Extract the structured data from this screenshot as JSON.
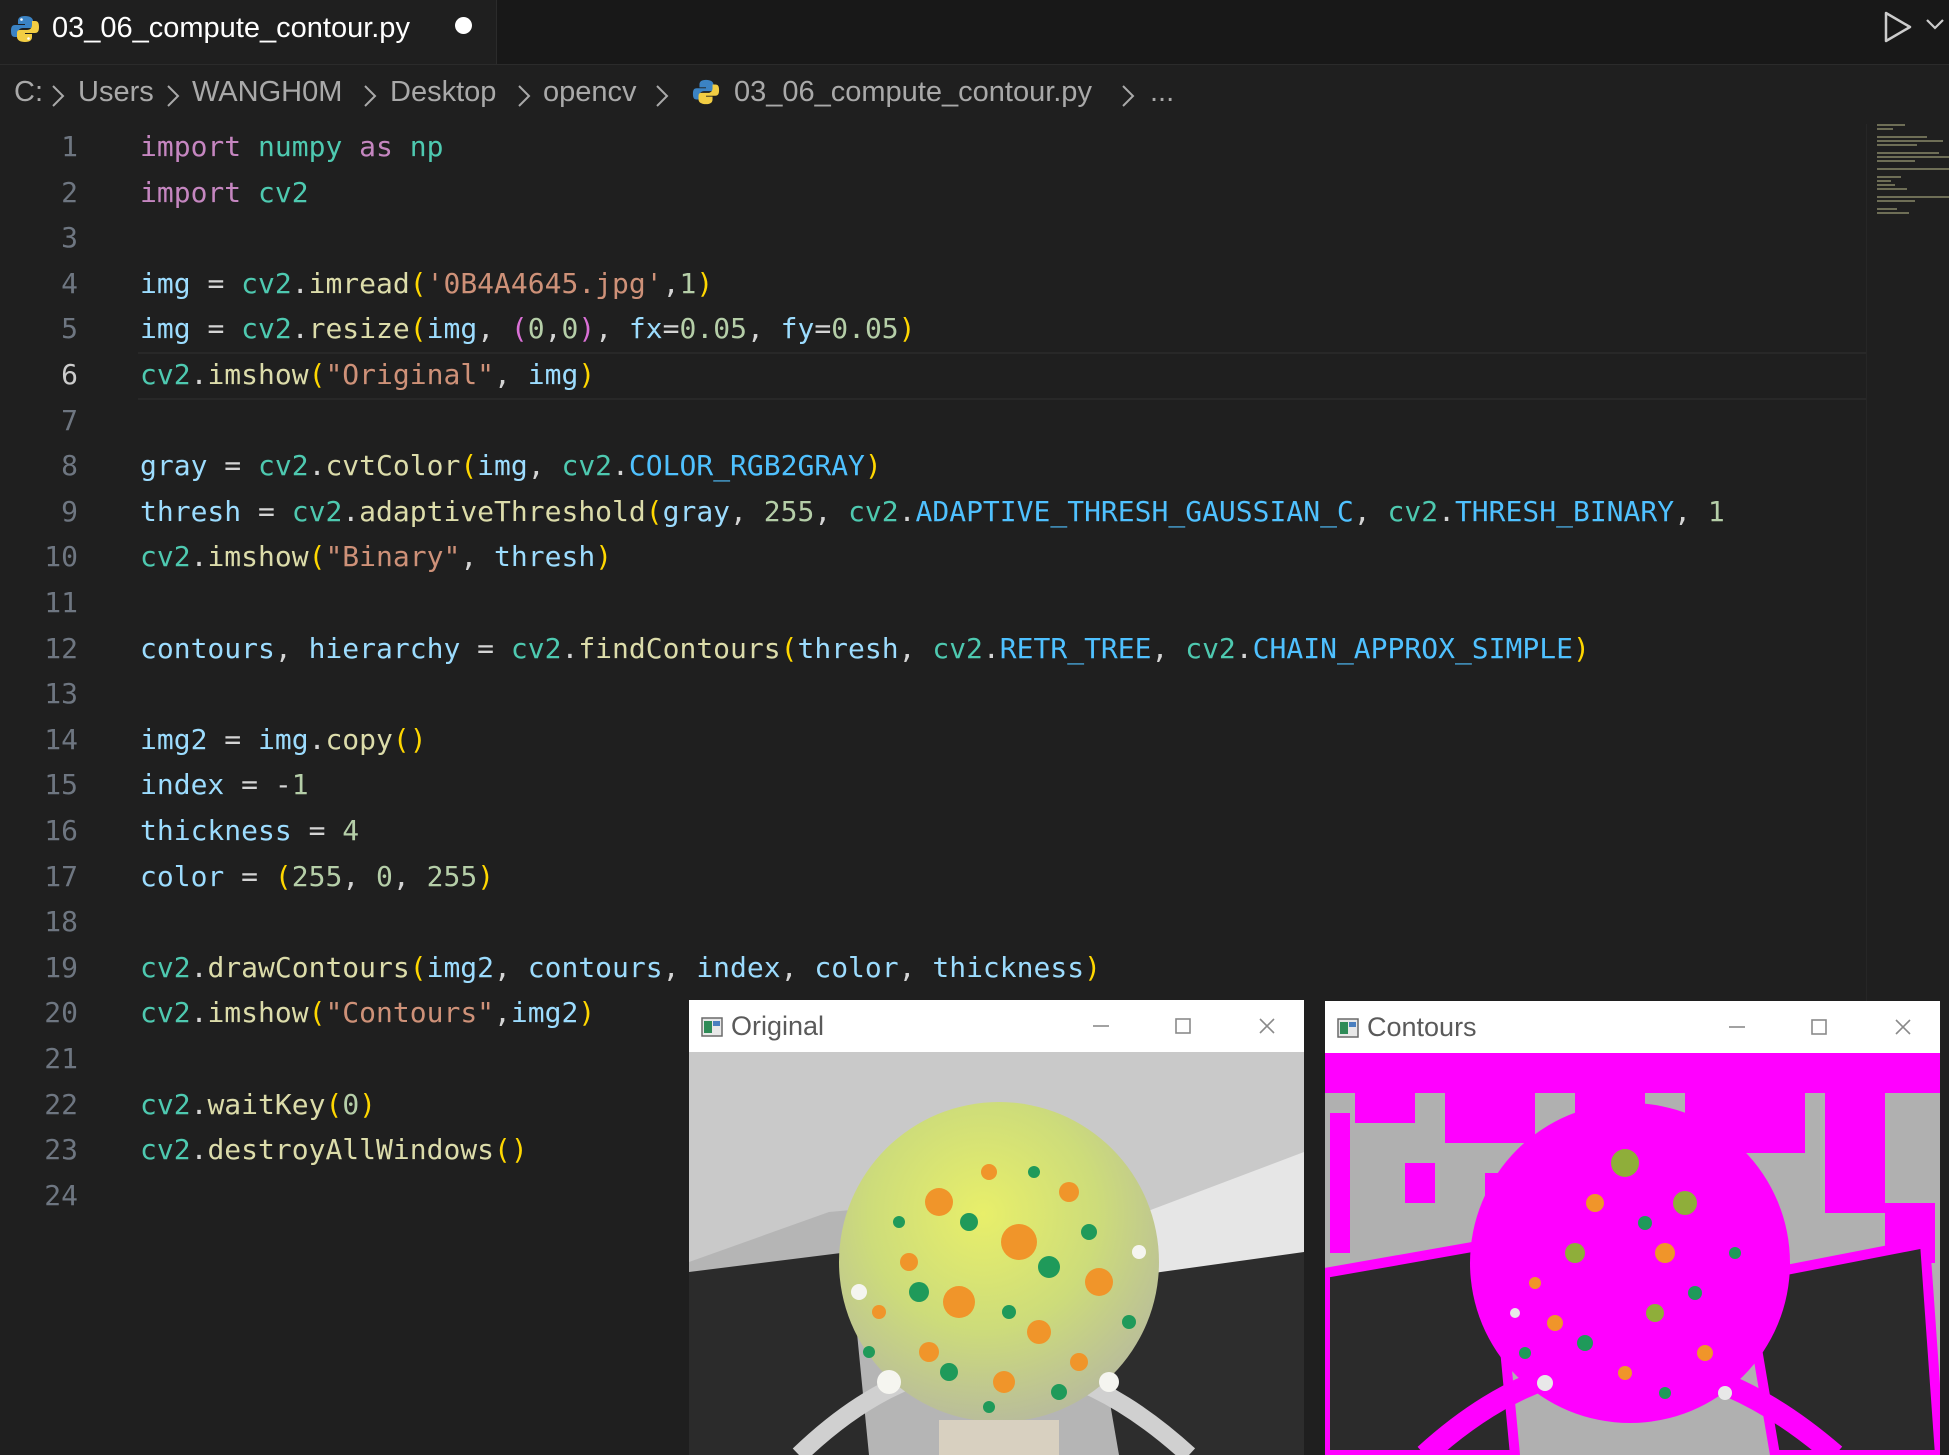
{
  "tab": {
    "filename": "03_06_compute_contour.py",
    "icon": "python-icon",
    "unsaved": true
  },
  "toolbar": {
    "run_icon": "run-icon",
    "run_menu_icon": "chevron-down-icon"
  },
  "breadcrumb": [
    "C:",
    "Users",
    "WANGH0M",
    "Desktop",
    "opencv",
    "03_06_compute_contour.py",
    "..."
  ],
  "editor": {
    "active_line": 6,
    "line_numbers": [
      "1",
      "2",
      "3",
      "4",
      "5",
      "6",
      "7",
      "8",
      "9",
      "10",
      "11",
      "12",
      "13",
      "14",
      "15",
      "16",
      "17",
      "18",
      "19",
      "20",
      "21",
      "22",
      "23",
      "24"
    ],
    "lines": [
      "import numpy as np",
      "import cv2",
      "",
      "img = cv2.imread('0B4A4645.jpg',1)",
      "img = cv2.resize(img, (0,0), fx=0.05, fy=0.05)",
      "cv2.imshow(\"Original\", img)",
      "",
      "gray = cv2.cvtColor(img, cv2.COLOR_RGB2GRAY)",
      "thresh = cv2.adaptiveThreshold(gray, 255, cv2.ADAPTIVE_THRESH_GAUSSIAN_C, cv2.THRESH_BINARY, 1",
      "cv2.imshow(\"Binary\", thresh)",
      "",
      "contours, hierarchy = cv2.findContours(thresh, cv2.RETR_TREE, cv2.CHAIN_APPROX_SIMPLE)",
      "",
      "img2 = img.copy()",
      "index = -1",
      "thickness = 4",
      "color = (255, 0, 255)",
      "",
      "cv2.drawContours(img2, contours, index, color, thickness)",
      "cv2.imshow(\"Contours\",img2)",
      "",
      "cv2.waitKey(0)",
      "cv2.destroyAllWindows()",
      ""
    ]
  },
  "windows": {
    "original": {
      "title": "Original",
      "icon": "app-window-icon"
    },
    "contours": {
      "title": "Contours",
      "icon": "app-window-icon"
    }
  },
  "window_controls": {
    "minimize": "minimize-icon",
    "maximize": "maximize-icon",
    "close": "close-icon"
  },
  "colors": {
    "contour": "#ff00ff",
    "editor_bg": "#1f1f1f",
    "tabbar_bg": "#181818"
  }
}
